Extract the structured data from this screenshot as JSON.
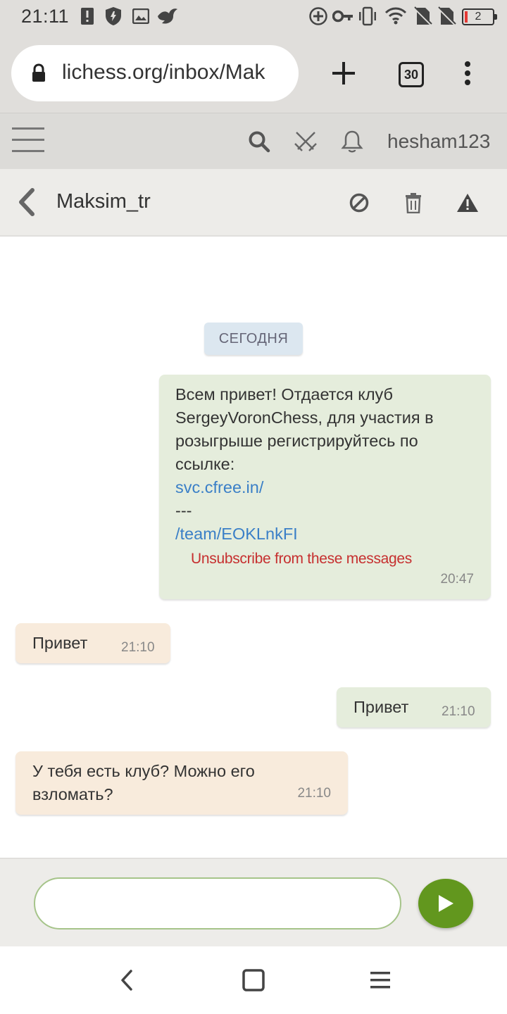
{
  "status_bar": {
    "time": "21:11",
    "battery_level": "2",
    "icons": [
      "alert-icon",
      "shield-icon",
      "image-icon",
      "bird-icon",
      "add-circle-icon",
      "key-icon",
      "vibrate-icon",
      "wifi-icon",
      "no-sim-icon",
      "no-sim-icon",
      "battery-icon"
    ]
  },
  "browser": {
    "url": "lichess.org/inbox/Mak",
    "tabs_count": "30"
  },
  "site_header": {
    "username": "hesham123"
  },
  "conversation": {
    "contact_name": "Maksim_tr"
  },
  "messages": {
    "day_label": "СЕГОДНЯ",
    "m1": {
      "text": "Всем привет! Отдается клуб SergeyVoronChess, для участия в розыгрыше регистрируйтесь по ссылке:",
      "link1": "svc.cfree.in/",
      "separator": "---",
      "link2": "/team/EOKLnkFI",
      "unsubscribe": "Unsubscribe from these messages",
      "time": "20:47"
    },
    "m2": {
      "text": "Привет",
      "time": "21:10"
    },
    "m3": {
      "text": "Привет",
      "time": "21:10"
    },
    "m4": {
      "text": "У тебя есть клуб? Можно его взломать?",
      "time": "21:10"
    }
  },
  "colors": {
    "mine_bubble": "#e5eddc",
    "theirs_bubble": "#f8ebdc",
    "link": "#3a7fc7",
    "unsubscribe": "#c62f2f",
    "send_button": "#62971e"
  }
}
